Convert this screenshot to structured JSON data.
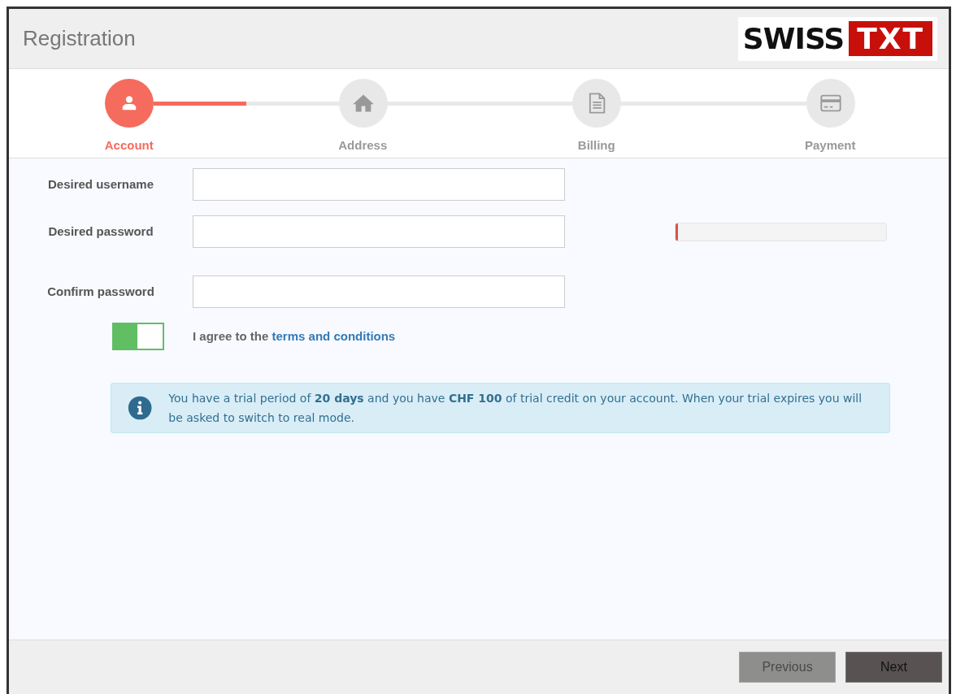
{
  "window": {
    "title": "Registration"
  },
  "logo": {
    "left": "SWISS",
    "right": "TXT"
  },
  "stepper": {
    "progress": {
      "level": 0.5
    },
    "steps": [
      {
        "label": "Account",
        "selected": true
      },
      {
        "label": "Address",
        "selected": false
      },
      {
        "label": "Billing",
        "selected": false
      },
      {
        "label": "Payment",
        "selected": false
      }
    ]
  },
  "form": {
    "fields": [
      {
        "label": "Desired username"
      },
      {
        "label": "Desired password",
        "strength": {
          "level": 0.01
        }
      },
      {
        "label": "Confirm password"
      }
    ],
    "agree": {
      "on": true,
      "text": "I agree to the ",
      "link": "terms and conditions"
    }
  },
  "info": {
    "text": "You have a trial period of **20 days** and you have **CHF 100** of trial credit on your account. When your trial expires you will be asked to switch to real mode."
  },
  "buttons": [
    {
      "label": "Previous",
      "disabled": true
    },
    {
      "label": "Next",
      "disabled": false
    }
  ]
}
